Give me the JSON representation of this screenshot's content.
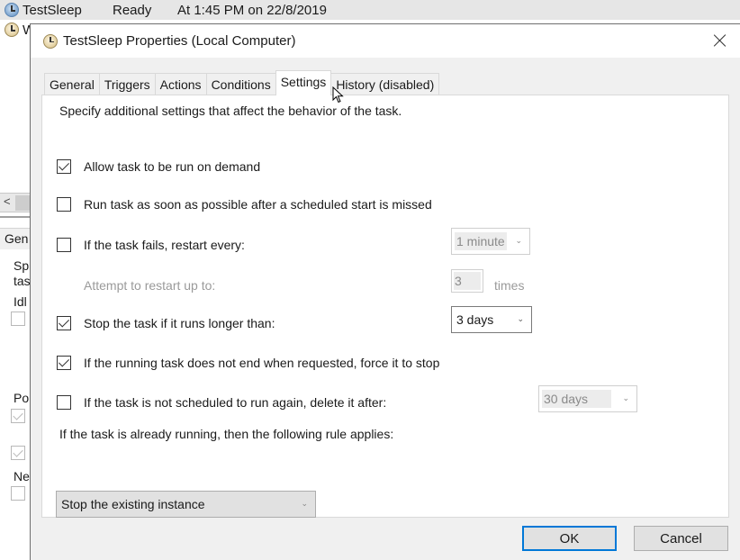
{
  "background": {
    "task_row": {
      "name": "TestSleep",
      "status": "Ready",
      "trigger": "At 1:45 PM on 22/8/2019"
    },
    "task_row2_partial": "W",
    "left_panel": {
      "scroll_left": "<",
      "tab_partial": "Gen",
      "texts": [
        "Sp",
        "tas",
        "Idl",
        "Po",
        "Ne"
      ]
    }
  },
  "dialog": {
    "title": "TestSleep Properties (Local Computer)",
    "tabs": [
      {
        "label": "General",
        "active": false
      },
      {
        "label": "Triggers",
        "active": false
      },
      {
        "label": "Actions",
        "active": false
      },
      {
        "label": "Conditions",
        "active": false
      },
      {
        "label": "Settings",
        "active": true
      },
      {
        "label": "History (disabled)",
        "active": false
      }
    ],
    "settings": {
      "intro": "Specify additional settings that affect the behavior of the task.",
      "allow_on_demand": {
        "label": "Allow task to be run on demand",
        "checked": true
      },
      "run_asap": {
        "label": "Run task as soon as possible after a scheduled start is missed",
        "checked": false
      },
      "restart_on_fail": {
        "label": "If the task fails, restart every:",
        "checked": false,
        "interval": "1 minute"
      },
      "restart_attempts": {
        "label": "Attempt to restart up to:",
        "value": "3",
        "unit": "times"
      },
      "stop_if_longer": {
        "label": "Stop the task if it runs longer than:",
        "checked": true,
        "duration": "3 days"
      },
      "force_stop": {
        "label": "If the running task does not end when requested, force it to stop",
        "checked": true
      },
      "delete_after": {
        "label": "If the task is not scheduled to run again, delete it after:",
        "checked": false,
        "duration": "30 days"
      },
      "running_rule_label": "If the task is already running, then the following rule applies:",
      "running_rule_value": "Stop the existing instance"
    },
    "buttons": {
      "ok": "OK",
      "cancel": "Cancel"
    }
  }
}
